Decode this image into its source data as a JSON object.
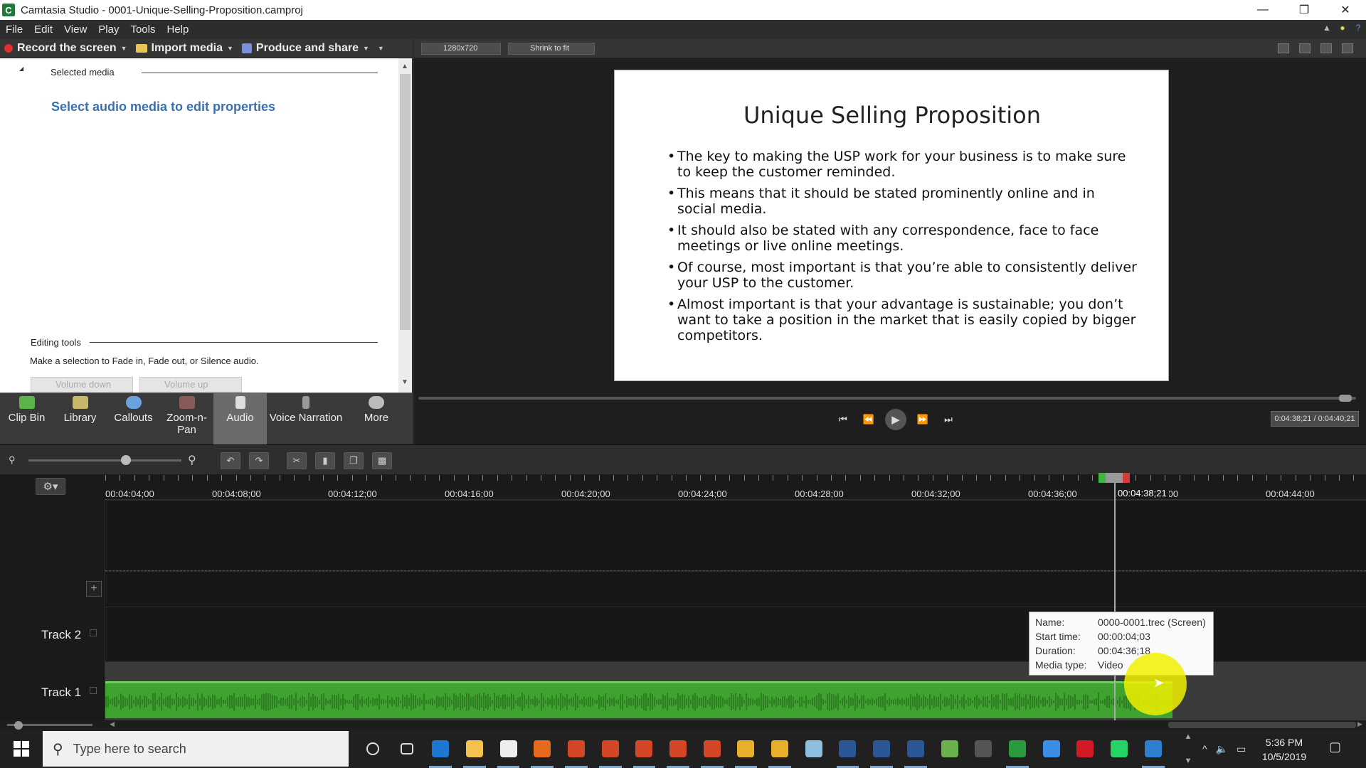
{
  "window": {
    "title": "Camtasia Studio - 0001-Unique-Selling-Proposition.camproj",
    "app_icon": "C"
  },
  "menu": [
    "File",
    "Edit",
    "View",
    "Play",
    "Tools",
    "Help"
  ],
  "toolbar": {
    "record": "Record the screen",
    "import": "Import media",
    "produce": "Produce and share"
  },
  "left_panel": {
    "header": "Selected media",
    "message": "Select audio media to edit properties",
    "editing_tools": "Editing tools",
    "editing_msg": "Make a selection to Fade in, Fade out, or Silence audio.",
    "volume_down": "Volume down",
    "volume_up": "Volume up"
  },
  "tabs": [
    {
      "label": "Clip Bin",
      "color": "#5bb34a"
    },
    {
      "label": "Library",
      "color": "#c8b86a"
    },
    {
      "label": "Callouts",
      "color": "#6aa2e0"
    },
    {
      "label": "Zoom-n-Pan",
      "color": "#8a5a5a"
    },
    {
      "label": "Audio",
      "color": "#dddddd"
    },
    {
      "label": "Voice Narration",
      "color": "#999999"
    },
    {
      "label": "More",
      "color": "#bbbbbb"
    }
  ],
  "preview": {
    "resolution": "1280x720",
    "zoom": "Shrink to fit",
    "slide_title": "Unique Selling Proposition",
    "bullets": [
      "The key to making the USP work for your business is to make sure to keep the customer reminded.",
      "This means that it should be stated prominently online and in social media.",
      "It should also be stated with any correspondence, face to face meetings or live online meetings.",
      "Of course, most important is that you’re able to consistently deliver your USP to the customer.",
      "Almost important is that your advantage is sustainable; you don’t want to take a position in the market that is easily copied by bigger competitors."
    ],
    "timecode": "0:04:38;21 / 0:04:40;21"
  },
  "timeline": {
    "ruler_labels": [
      "00:04:04;00",
      "00:04:08;00",
      "00:04:12;00",
      "00:04:16;00",
      "00:04:20;00",
      "00:04:24;00",
      "00:04:28;00",
      "00:04:32;00",
      "00:04:36;00",
      ":40;00",
      "00:04:44;00"
    ],
    "playhead_label": "00:04:38;21",
    "tracks": [
      "Track 2",
      "Track 1"
    ],
    "clip_color": "#3fa42f"
  },
  "tooltip": {
    "rows": [
      {
        "k": "Name:",
        "v": "0000-0001.trec (Screen)"
      },
      {
        "k": "Start time:",
        "v": "00:00:04;03"
      },
      {
        "k": "Duration:",
        "v": "00:04:36;18"
      },
      {
        "k": "Media type:",
        "v": "Video"
      }
    ]
  },
  "taskbar": {
    "search_placeholder": "Type here to search",
    "time": "5:36 PM",
    "date": "10/5/2019",
    "apps": [
      {
        "name": "cortana-icon",
        "color": "#202020"
      },
      {
        "name": "task-view-icon",
        "color": "#202020"
      },
      {
        "name": "edge-icon",
        "color": "#1e78d2"
      },
      {
        "name": "file-explorer-icon",
        "color": "#f2c14e"
      },
      {
        "name": "camtasia-recorder-icon",
        "color": "#eeeeee"
      },
      {
        "name": "firefox-icon",
        "color": "#e66a1e"
      },
      {
        "name": "powerpoint-icon-1",
        "color": "#d24726"
      },
      {
        "name": "powerpoint-icon-2",
        "color": "#d24726"
      },
      {
        "name": "powerpoint-icon-3",
        "color": "#d24726"
      },
      {
        "name": "powerpoint-icon-4",
        "color": "#d24726"
      },
      {
        "name": "powerpoint-icon-5",
        "color": "#d24726"
      },
      {
        "name": "chrome-icon-1",
        "color": "#e8b02a"
      },
      {
        "name": "chrome-icon-2",
        "color": "#e8b02a"
      },
      {
        "name": "notepad-icon",
        "color": "#8fbfe0"
      },
      {
        "name": "word-icon-1",
        "color": "#2b5797"
      },
      {
        "name": "word-icon-2",
        "color": "#2b5797"
      },
      {
        "name": "word-icon-3",
        "color": "#2b5797"
      },
      {
        "name": "meeting-icon",
        "color": "#6ab04c"
      },
      {
        "name": "calculator-icon",
        "color": "#555555"
      },
      {
        "name": "camtasia-icon",
        "color": "#2b9a3e"
      },
      {
        "name": "checkmark-app-icon",
        "color": "#3a8ee6"
      },
      {
        "name": "opera-icon",
        "color": "#d31925"
      },
      {
        "name": "whatsapp-icon",
        "color": "#25d366"
      },
      {
        "name": "remote-desktop-icon",
        "color": "#2f7fd1"
      }
    ]
  }
}
